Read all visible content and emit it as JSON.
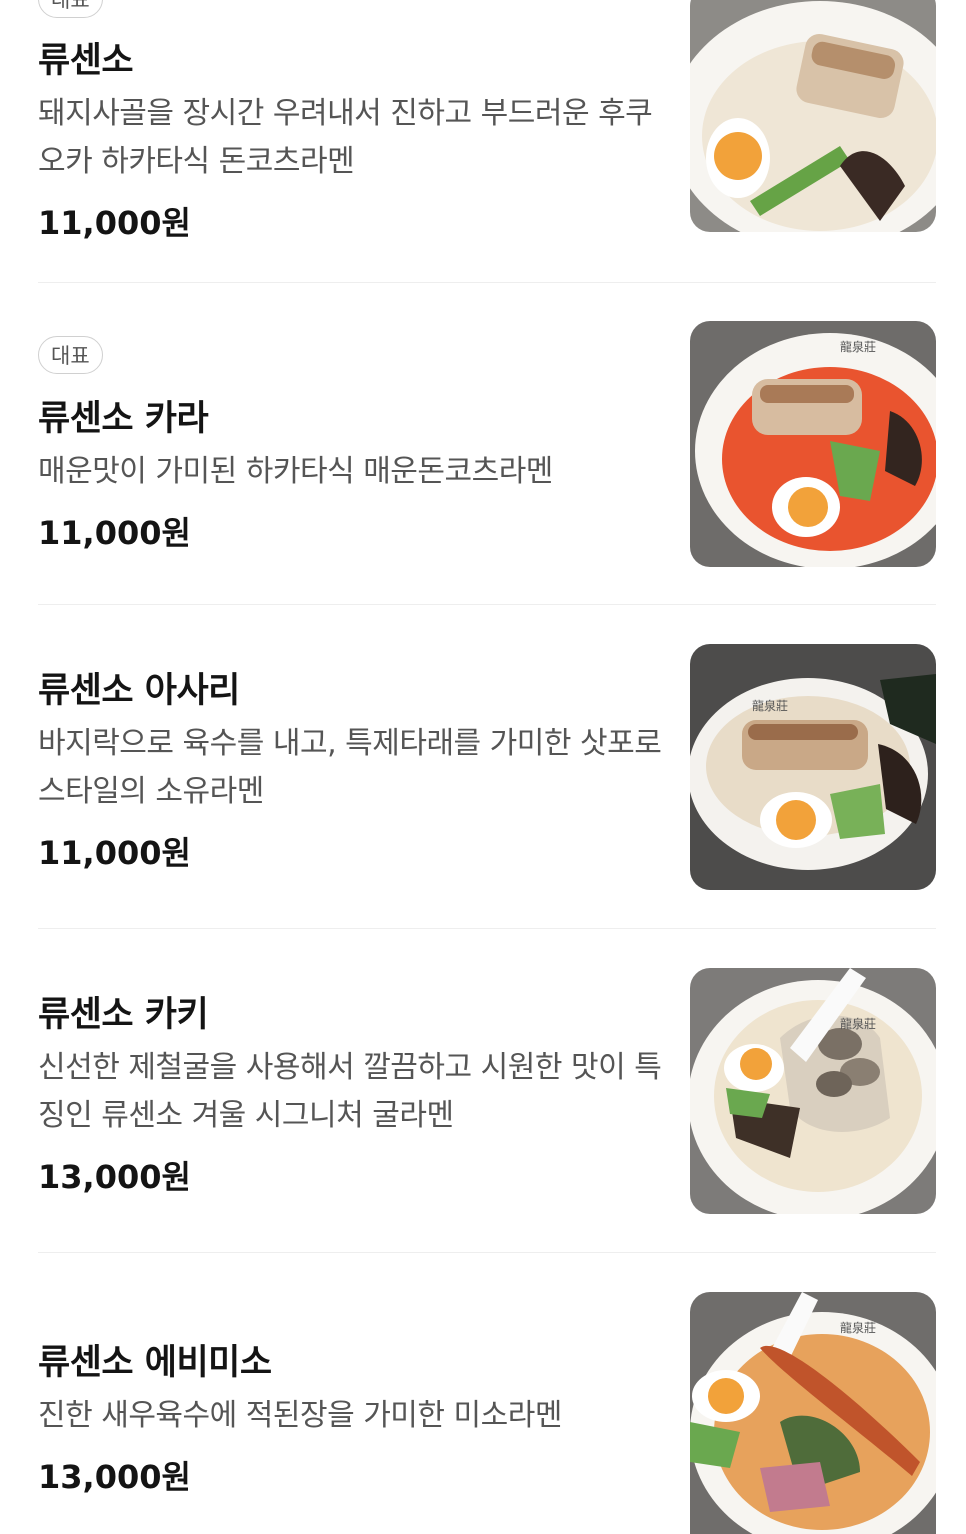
{
  "menu": {
    "items": [
      {
        "badge": "대표",
        "name": "류센소",
        "desc": "돼지사골을 장시간 우려내서 진하고 부드러운 후쿠오카 하카타식 돈코츠라멘",
        "price": "11,000원",
        "image": {
          "broth": "#efe6d6",
          "accent": "#f2a23a"
        }
      },
      {
        "badge": "대표",
        "name": "류센소 카라",
        "desc": "매운맛이 가미된 하카타식 매운돈코츠라멘",
        "price": "11,000원",
        "image": {
          "broth": "#e9542f",
          "accent": "#f2a23a"
        }
      },
      {
        "badge": "",
        "name": "류센소 아사리",
        "desc": "바지락으로 육수를 내고, 특제타래를 가미한 삿포로 스타일의 소유라멘",
        "price": "11,000원",
        "image": {
          "broth": "#e8dcc8",
          "accent": "#f2a23a"
        }
      },
      {
        "badge": "",
        "name": "류센소 카키",
        "desc": "신선한 제철굴을 사용해서 깔끔하고 시원한 맛이 특징인 류센소 겨울 시그니처 굴라멘",
        "price": "13,000원",
        "image": {
          "broth": "#efe4cf",
          "accent": "#f2a23a"
        }
      },
      {
        "badge": "",
        "name": "류센소 에비미소",
        "desc": "진한 새우육수에 적된장을 가미한 미소라멘",
        "price": "13,000원",
        "image": {
          "broth": "#e7a25c",
          "accent": "#f2a23a"
        }
      }
    ]
  }
}
